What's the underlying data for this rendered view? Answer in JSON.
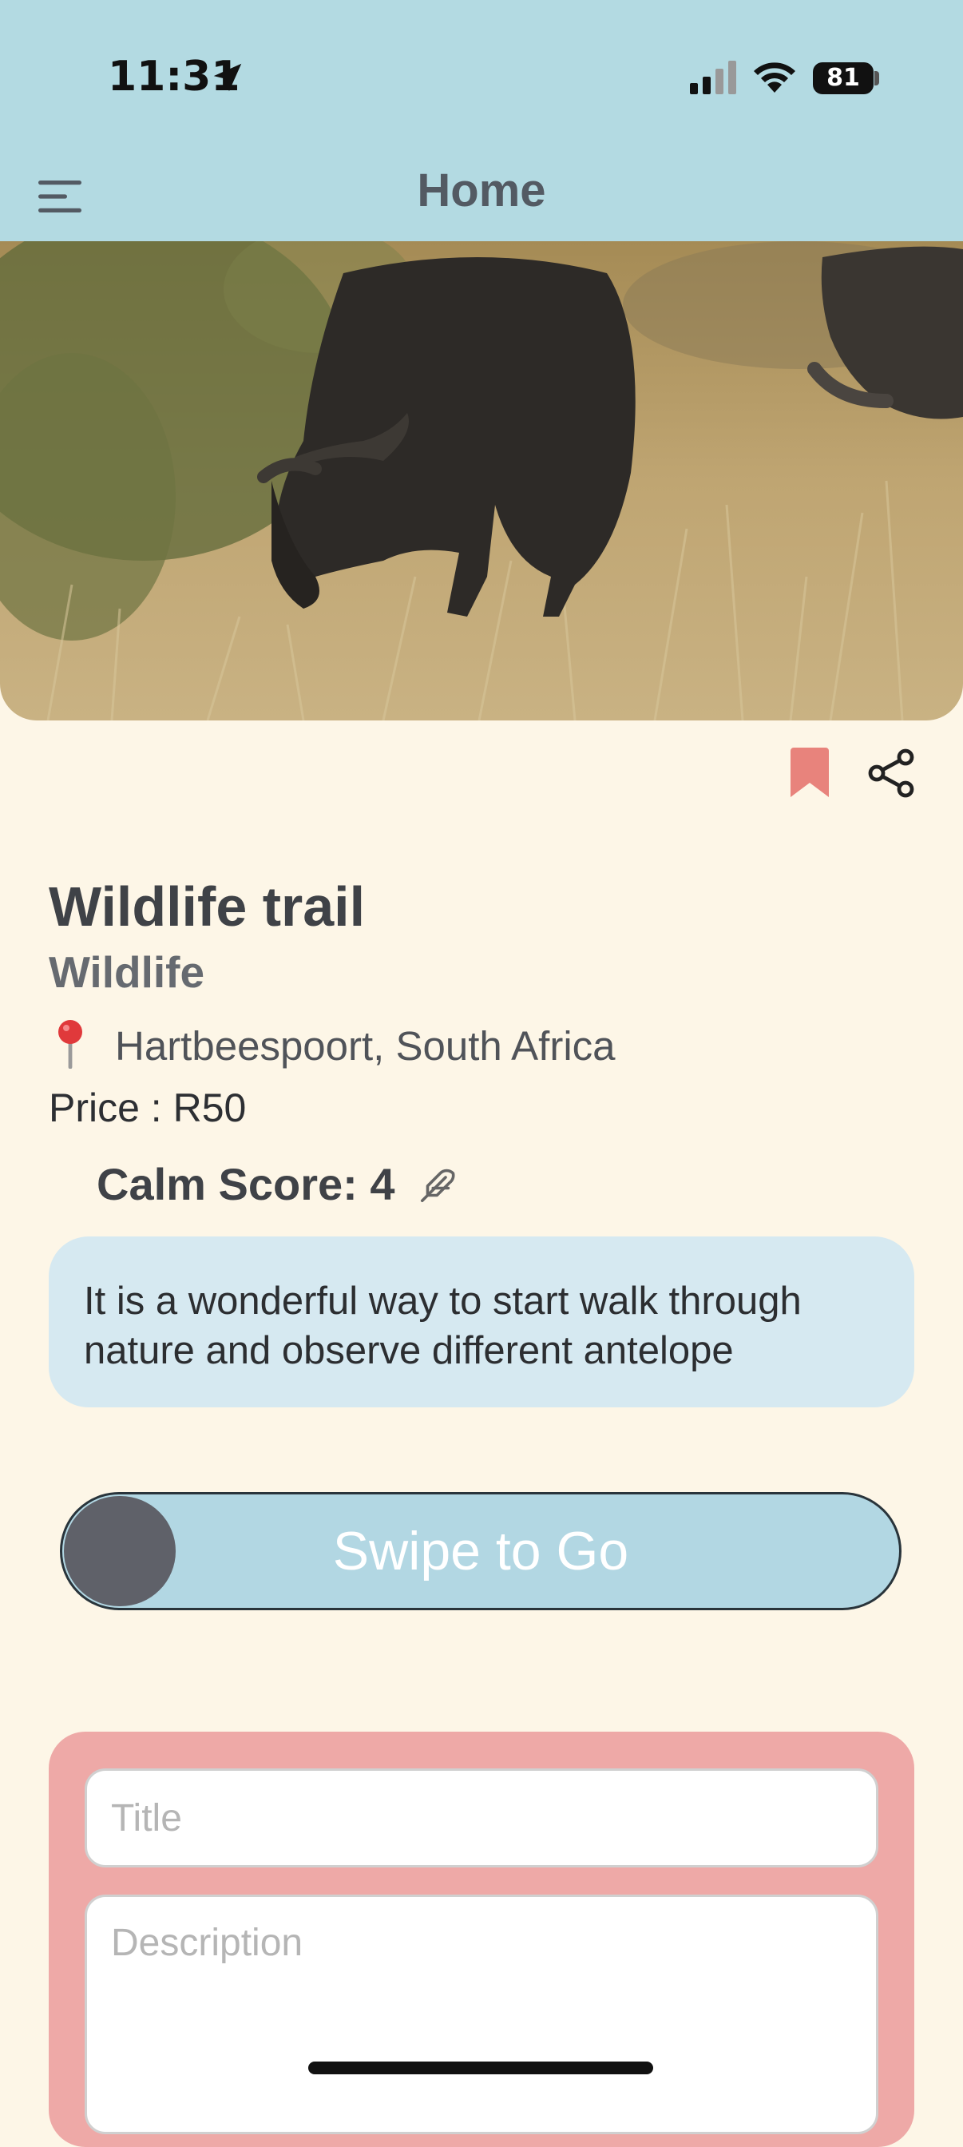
{
  "status_bar": {
    "time": "11:31",
    "battery": "81"
  },
  "header": {
    "title": "Home"
  },
  "activity": {
    "title": "Wildlife trail",
    "category": "Wildlife",
    "location": "Hartbeespoort, South Africa",
    "price": "Price : R50",
    "calm_score": "Calm Score: 4",
    "description": "It is a wonderful way to start walk through nature and observe different antelope"
  },
  "swipe": {
    "label": "Swipe to Go"
  },
  "form": {
    "title_placeholder": "Title",
    "description_placeholder": "Description"
  },
  "icons": {
    "menu": "hamburger-menu-icon",
    "bookmark": "bookmark-icon",
    "share": "share-icon",
    "pin": "map-pin-icon",
    "feather": "feather-icon"
  },
  "colors": {
    "header_bg": "#b3dae2",
    "page_bg": "#fdf6e7",
    "bookmark": "#e8837c",
    "card_bg": "#d6e9f1",
    "swipe_track": "#b2d7e3",
    "swipe_knob": "#5f6169",
    "form_bg": "#eea9a7"
  }
}
